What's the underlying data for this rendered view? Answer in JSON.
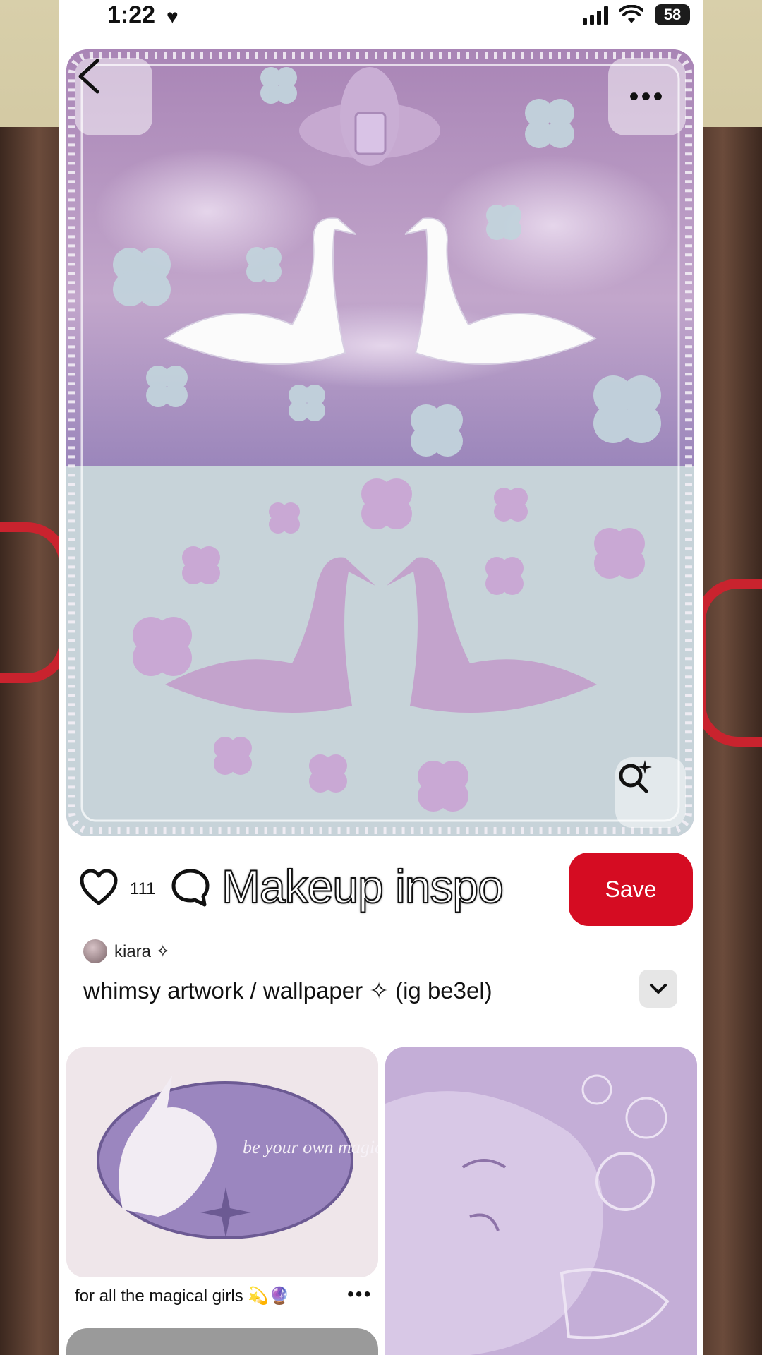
{
  "status_bar": {
    "time": "1:22",
    "heart": "♥",
    "battery": "58"
  },
  "hero": {
    "more_label": "•••"
  },
  "actions": {
    "like_count": "111",
    "overlay_caption": "Makeup inspo",
    "save_label": "Save"
  },
  "pin": {
    "author": "kiara ✧",
    "title": "whimsy artwork / wallpaper ✧ (ig be3el)"
  },
  "related": [
    {
      "image_text": "be your own magical girl !",
      "caption": "for all the magical girls 💫🔮",
      "more_label": "•••"
    }
  ],
  "colors": {
    "save_button": "#d50c22",
    "glasses": "#c9232e",
    "hero_upper": "#b998c2",
    "hero_lower": "#c7d3d9"
  },
  "icons": [
    "back-arrow-icon",
    "more-icon",
    "visual-search-icon",
    "heart-icon",
    "comment-icon",
    "chevron-down-icon"
  ]
}
